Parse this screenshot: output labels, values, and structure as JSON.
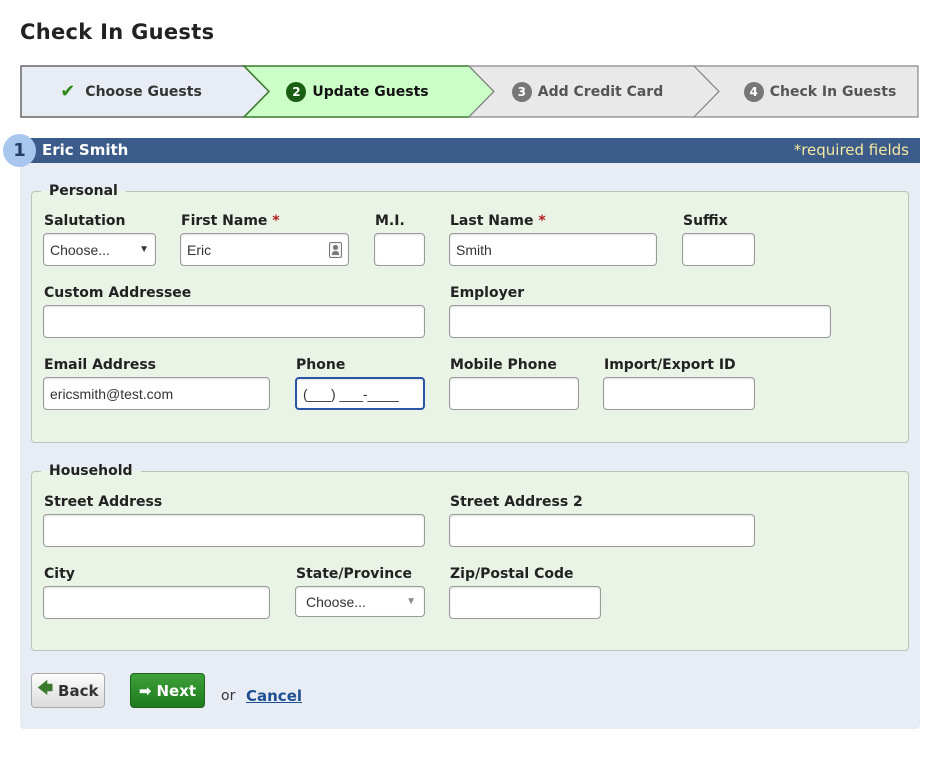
{
  "page": {
    "title": "Check In Guests"
  },
  "wizard": {
    "steps": [
      {
        "label": "Choose Guests",
        "state": "done"
      },
      {
        "num": "2",
        "label": "Update Guests",
        "state": "current"
      },
      {
        "num": "3",
        "label": "Add Credit Card",
        "state": "todo"
      },
      {
        "num": "4",
        "label": "Check In Guests",
        "state": "todo"
      }
    ]
  },
  "guest": {
    "index": "1",
    "name": "Eric Smith",
    "required_note": "*required fields"
  },
  "personal": {
    "legend": "Personal",
    "salutation": {
      "label": "Salutation",
      "value": "Choose..."
    },
    "first_name": {
      "label": "First Name",
      "value": "Eric"
    },
    "mi": {
      "label": "M.I.",
      "value": ""
    },
    "last_name": {
      "label": "Last Name",
      "value": "Smith"
    },
    "suffix": {
      "label": "Suffix",
      "value": ""
    },
    "custom_addressee": {
      "label": "Custom Addressee",
      "value": ""
    },
    "employer": {
      "label": "Employer",
      "value": ""
    },
    "email": {
      "label": "Email Address",
      "value": "ericsmith@test.com"
    },
    "phone": {
      "label": "Phone",
      "value": "(___) ___-____"
    },
    "mobile_phone": {
      "label": "Mobile Phone",
      "value": ""
    },
    "import_export_id": {
      "label": "Import/Export ID",
      "value": ""
    }
  },
  "household": {
    "legend": "Household",
    "street": {
      "label": "Street Address",
      "value": ""
    },
    "street2": {
      "label": "Street Address 2",
      "value": ""
    },
    "city": {
      "label": "City",
      "value": ""
    },
    "state": {
      "label": "State/Province",
      "value": "Choose..."
    },
    "zip": {
      "label": "Zip/Postal Code",
      "value": ""
    }
  },
  "actions": {
    "back": "Back",
    "next": "Next",
    "or": "or",
    "cancel": "Cancel"
  },
  "colors": {
    "header_bg": "#3b5b8a",
    "required_text": "#f5e9a0",
    "current_step_bg": "#ccffc7",
    "next_button": "#2a8c26",
    "link": "#1d4f91"
  }
}
